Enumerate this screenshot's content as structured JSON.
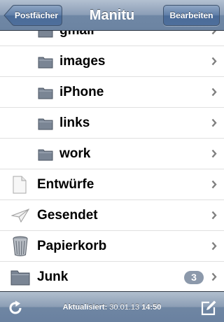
{
  "navbar": {
    "back_label": "Postfächer",
    "title": "Manitu",
    "edit_label": "Bearbeiten"
  },
  "folders": [
    {
      "label": "gmail",
      "icon": "folder-icon",
      "indent": true,
      "partial": true
    },
    {
      "label": "images",
      "icon": "folder-icon",
      "indent": true
    },
    {
      "label": "iPhone",
      "icon": "folder-icon",
      "indent": true
    },
    {
      "label": "links",
      "icon": "folder-icon",
      "indent": true
    },
    {
      "label": "work",
      "icon": "folder-icon",
      "indent": true
    },
    {
      "label": "Entwürfe",
      "icon": "draft-icon",
      "indent": false
    },
    {
      "label": "Gesendet",
      "icon": "sent-icon",
      "indent": false
    },
    {
      "label": "Papierkorb",
      "icon": "trash-icon",
      "indent": false
    },
    {
      "label": "Junk",
      "icon": "folder-icon",
      "indent": false,
      "badge": "3"
    }
  ],
  "toolbar": {
    "updated_label": "Aktualisiert:",
    "date": "30.01.13",
    "time": "14:50"
  },
  "colors": {
    "accent": "#6c84a2",
    "badge": "#8c99ab"
  }
}
